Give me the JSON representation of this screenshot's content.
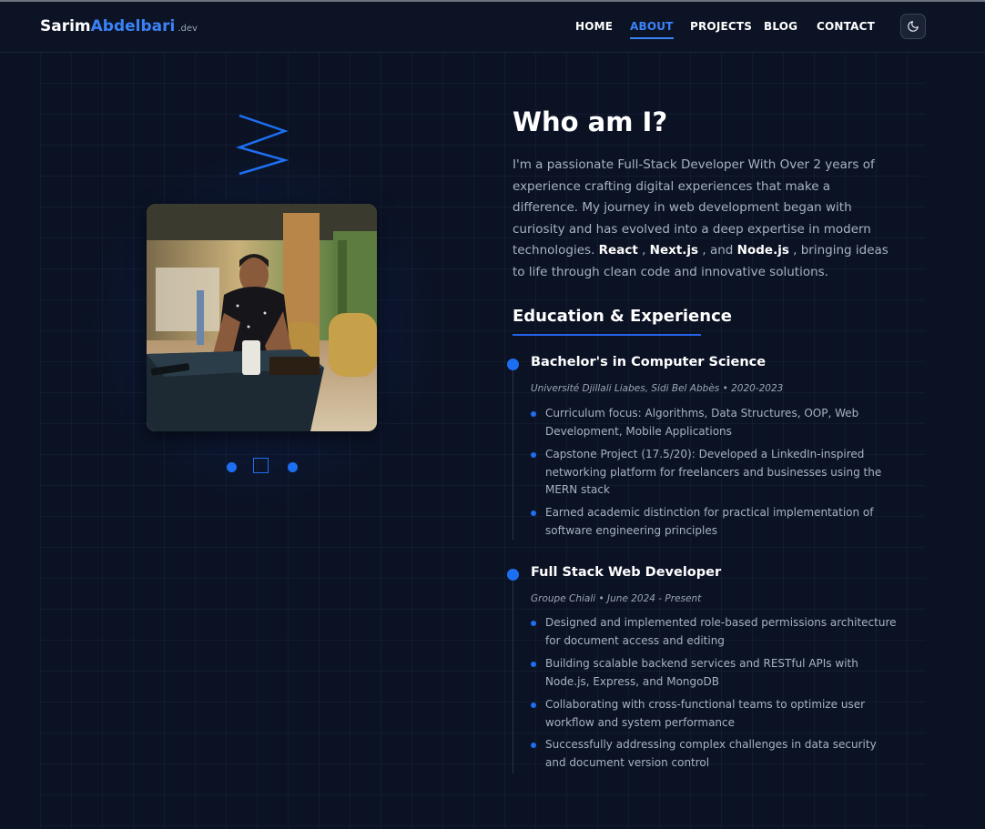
{
  "header": {
    "logo_first": "Sarim",
    "logo_last": "Abdelbari",
    "logo_tld": ".dev",
    "nav": [
      "HOME",
      "ABOUT",
      "PROJECTS",
      "BLOG",
      "CONTACT"
    ],
    "active_nav": "ABOUT",
    "theme_icon": "moon-icon"
  },
  "about": {
    "title": "Who am I?",
    "intro_1": "I'm a passionate Full-Stack Developer With Over 2 years of experience crafting digital experiences that make a difference. My journey in web development began with curiosity and has evolved into a deep expertise in modern technologies.",
    "tech_1": "React",
    "sep_1": " ,",
    "tech_2": "Next.js",
    "sep_2": " , and",
    "tech_3": "Node.js",
    "intro_2": " , bringing ideas to life through clean code and innovative solutions."
  },
  "education": {
    "heading": "Education & Experience",
    "items": [
      {
        "title": "Bachelor's in Computer Science",
        "meta": "Université Djillali Liabes, Sidi Bel Abbès • 2020-2023",
        "bullets": [
          "Curriculum focus: Algorithms, Data Structures, OOP, Web Development, Mobile Applications",
          "Capstone Project (17.5/20): Developed a LinkedIn-inspired networking platform for freelancers and businesses using the MERN stack",
          "Earned academic distinction for practical implementation of software engineering principles"
        ]
      },
      {
        "title": "Full Stack Web Developer",
        "meta": "Groupe Chiali • June 2024 - Present",
        "bullets": [
          "Designed and implemented role-based permissions architecture for document access and editing",
          "Building scalable backend services and RESTful APIs with Node.js, Express, and MongoDB",
          "Collaborating with cross-functional teams to optimize user workflow and system performance",
          "Successfully addressing complex challenges in data security and document version control"
        ]
      }
    ]
  },
  "colors": {
    "accent": "#1d6ff2",
    "background": "#0b1224",
    "text_muted": "#a8b1c4"
  }
}
